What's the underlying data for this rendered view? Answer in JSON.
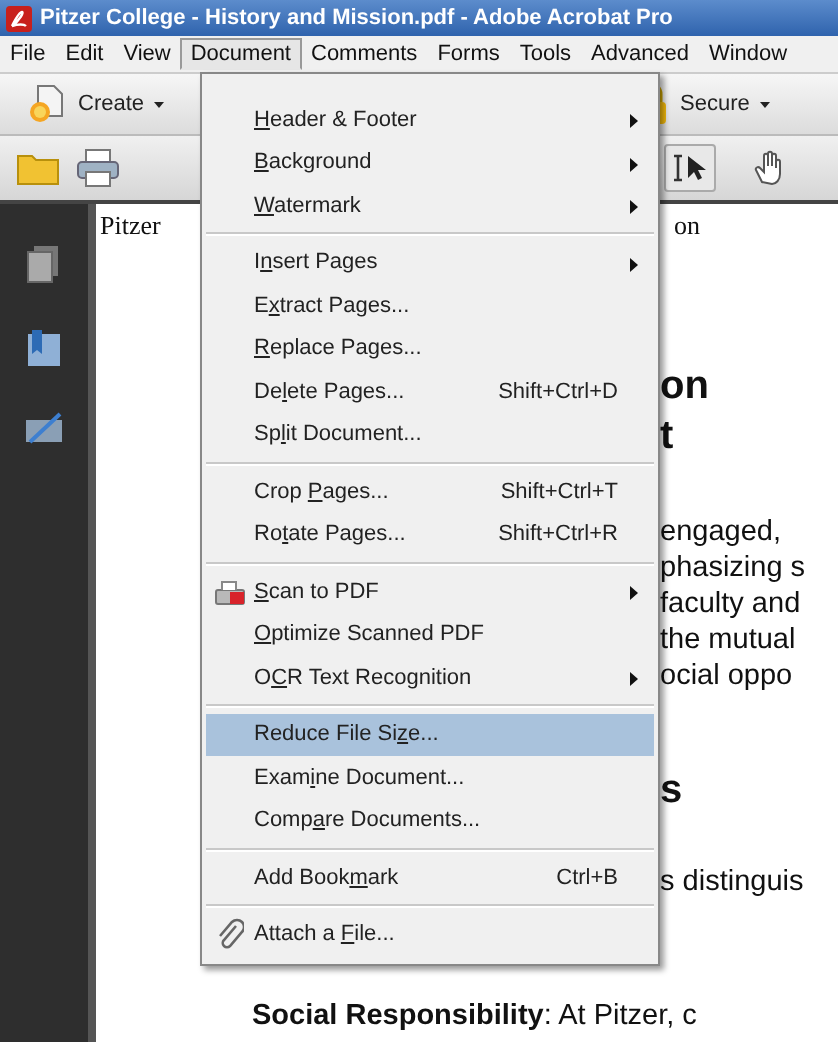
{
  "window": {
    "title": "Pitzer College - History and Mission.pdf - Adobe Acrobat Pro"
  },
  "menu_bar": [
    {
      "label": "File",
      "selected": false
    },
    {
      "label": "Edit",
      "selected": false
    },
    {
      "label": "View",
      "selected": false
    },
    {
      "label": "Document",
      "selected": true
    },
    {
      "label": "Comments",
      "selected": false
    },
    {
      "label": "Forms",
      "selected": false
    },
    {
      "label": "Tools",
      "selected": false
    },
    {
      "label": "Advanced",
      "selected": false
    },
    {
      "label": "Window",
      "selected": false
    }
  ],
  "task_buttons": [
    {
      "label": "Create"
    },
    {
      "label": "Secure"
    }
  ],
  "tools": [
    {
      "kind": "select",
      "selected": true
    },
    {
      "kind": "hand",
      "selected": false
    }
  ],
  "document_menu": [
    {
      "kind": "item",
      "key": "H",
      "after": "eader & Footer",
      "submenu": true,
      "selected": false
    },
    {
      "kind": "item",
      "key": "B",
      "after": "ackground",
      "submenu": true,
      "selected": false
    },
    {
      "kind": "item",
      "key": "W",
      "after": "atermark",
      "submenu": true,
      "selected": false
    },
    {
      "kind": "separator"
    },
    {
      "kind": "item",
      "before": "I",
      "key": "n",
      "after": "sert Pages",
      "submenu": true,
      "selected": false
    },
    {
      "kind": "item",
      "before": "E",
      "key": "x",
      "after": "tract Pages...",
      "submenu": false,
      "selected": false
    },
    {
      "kind": "item",
      "key": "R",
      "after": "eplace Pages...",
      "submenu": false,
      "selected": false
    },
    {
      "kind": "item",
      "before": "De",
      "key": "l",
      "after": "ete Pages...",
      "shortcut": "Shift+Ctrl+D",
      "submenu": false,
      "selected": false
    },
    {
      "kind": "item",
      "before": "Sp",
      "key": "l",
      "after": "it Document...",
      "submenu": false,
      "selected": false
    },
    {
      "kind": "separator"
    },
    {
      "kind": "item",
      "before": "Crop ",
      "key": "P",
      "after": "ages...",
      "shortcut": "Shift+Ctrl+T",
      "submenu": false,
      "selected": false
    },
    {
      "kind": "item",
      "before": "Ro",
      "key": "t",
      "after": "ate Pages...",
      "shortcut": "Shift+Ctrl+R",
      "submenu": false,
      "selected": false
    },
    {
      "kind": "separator"
    },
    {
      "kind": "item",
      "key": "S",
      "after": "can to PDF",
      "submenu": true,
      "selected": false
    },
    {
      "kind": "item",
      "key": "O",
      "after": "ptimize Scanned PDF",
      "submenu": false,
      "selected": false
    },
    {
      "kind": "item",
      "before": "O",
      "key": "C",
      "after": "R Text Recognition",
      "submenu": true,
      "selected": false
    },
    {
      "kind": "separator"
    },
    {
      "kind": "item",
      "before": "Reduce File Si",
      "key": "z",
      "after": "e...",
      "submenu": false,
      "selected": true
    },
    {
      "kind": "item",
      "before": "Exam",
      "key": "i",
      "after": "ne Document...",
      "submenu": false,
      "selected": false
    },
    {
      "kind": "item",
      "before": "Comp",
      "key": "a",
      "after": "re Documents...",
      "submenu": false,
      "selected": false
    },
    {
      "kind": "separator"
    },
    {
      "kind": "item",
      "before": "Add Book",
      "key": "m",
      "after": "ark",
      "shortcut": "Ctrl+B",
      "submenu": false,
      "selected": false
    },
    {
      "kind": "separator"
    },
    {
      "kind": "item",
      "before": "Attach a ",
      "key": "F",
      "after": "ile...",
      "submenu": false,
      "selected": false
    }
  ],
  "document": {
    "left_text": "Pitzer",
    "header_fragment": "on",
    "heading_fragments": [
      "on",
      "t"
    ],
    "body_fragments": [
      "engaged,",
      "phasizing s",
      "faculty and",
      "the mutual",
      "ocial oppo"
    ],
    "heading2_fragment": "s",
    "paragraph_fragment": "s distinguis",
    "bottom_line": "**Social Responsibility**: At Pitzer, c"
  }
}
